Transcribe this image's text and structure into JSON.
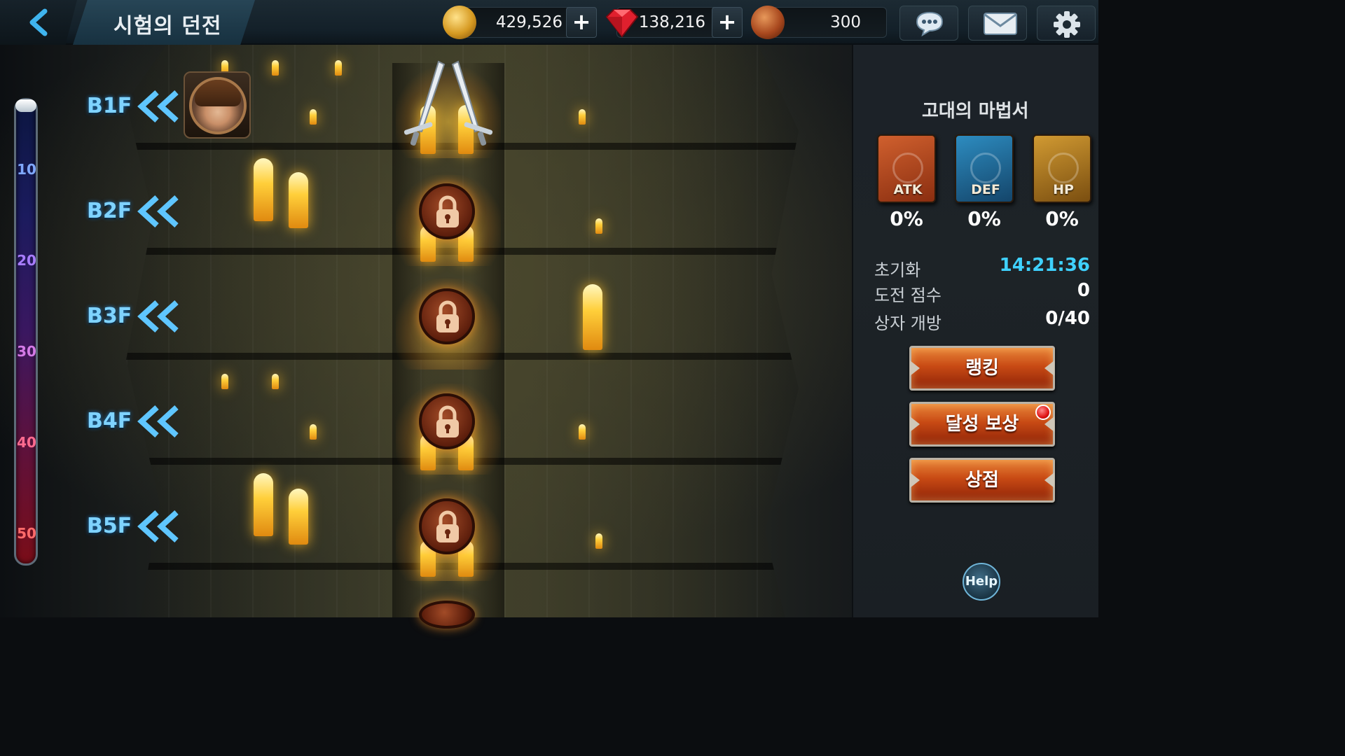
{
  "header": {
    "title": "시험의 던전",
    "gold": "429,526",
    "gems": "138,216",
    "tokens": "300"
  },
  "gauge": {
    "ticks": [
      {
        "label": "10",
        "color": "#7fa8ff"
      },
      {
        "label": "20",
        "color": "#a87dff"
      },
      {
        "label": "30",
        "color": "#d47ae6"
      },
      {
        "label": "40",
        "color": "#ff6b8f"
      },
      {
        "label": "50",
        "color": "#ff6b6b"
      }
    ]
  },
  "floors": [
    "B1F",
    "B2F",
    "B3F",
    "B4F",
    "B5F"
  ],
  "panel": {
    "book_title": "고대의 마법서",
    "books": [
      {
        "label": "ATK",
        "percent": "0%",
        "color": "#b5431f"
      },
      {
        "label": "DEF",
        "percent": "0%",
        "color": "#1e6f9a"
      },
      {
        "label": "HP",
        "percent": "0%",
        "color": "#b07a1c"
      }
    ],
    "stats": [
      {
        "label": "초기화",
        "value": "14:21:36"
      },
      {
        "label": "도전 점수",
        "value": "0"
      },
      {
        "label": "상자 개방",
        "value": "0/40"
      }
    ],
    "buttons": {
      "ranking": "랭킹",
      "achievement": "달성 보상",
      "shop": "상점"
    },
    "help": "Help"
  },
  "colors": {
    "accent_blue": "#3fd1ff",
    "floor_label": "#7fd3ff",
    "button_orange": "#c84a14"
  }
}
